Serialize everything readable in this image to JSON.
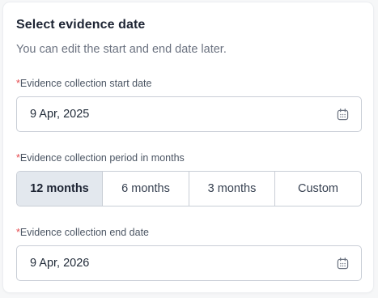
{
  "dialog": {
    "title": "Select evidence date",
    "subtitle": "You can edit the start and end date later."
  },
  "start_date": {
    "required_mark": "*",
    "label": "Evidence collection start date",
    "value": "9 Apr, 2025",
    "icon": "calendar-icon"
  },
  "period": {
    "required_mark": "*",
    "label": "Evidence collection period in months",
    "options": [
      {
        "label": "12 months",
        "selected": true
      },
      {
        "label": "6 months",
        "selected": false
      },
      {
        "label": "3 months",
        "selected": false
      },
      {
        "label": "Custom",
        "selected": false
      }
    ]
  },
  "end_date": {
    "required_mark": "*",
    "label": "Evidence collection end date",
    "value": "9 Apr, 2026",
    "icon": "calendar-icon"
  },
  "colors": {
    "required": "#e5484d",
    "selected_segment_bg": "#e3e8ee",
    "border": "#c9ced6"
  }
}
